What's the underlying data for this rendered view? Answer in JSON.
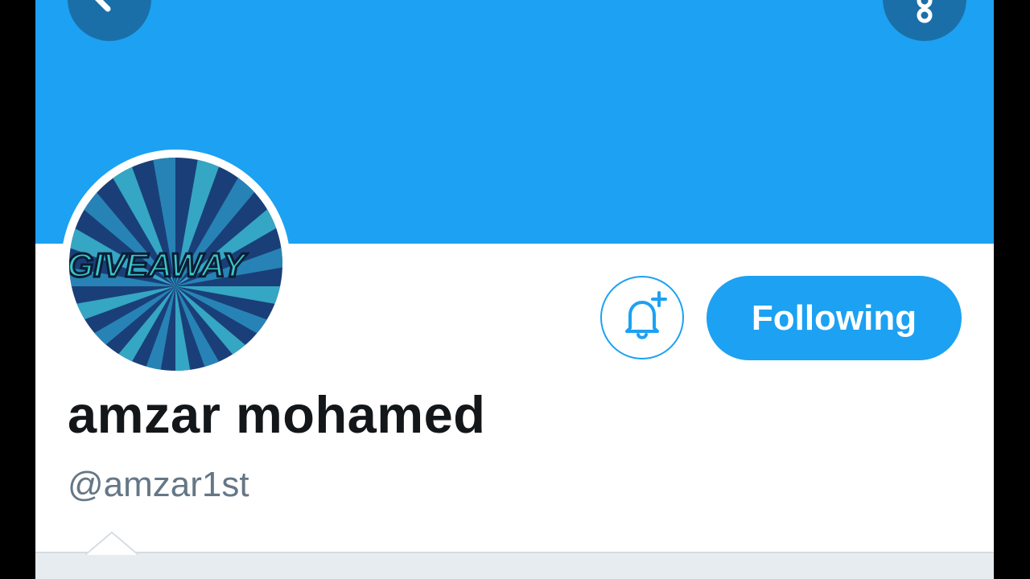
{
  "profile": {
    "display_name": "amzar mohamed",
    "handle": "@amzar1st",
    "avatar_text": "GIVEAWAY"
  },
  "actions": {
    "following_label": "Following",
    "notify_icon": "bell-plus-icon",
    "back_icon": "arrow-left-icon",
    "more_icon": "more-vertical-icon"
  },
  "colors": {
    "banner": "#1da1f2",
    "accent": "#1da1f2",
    "name": "#14171a",
    "handle": "#657786"
  }
}
